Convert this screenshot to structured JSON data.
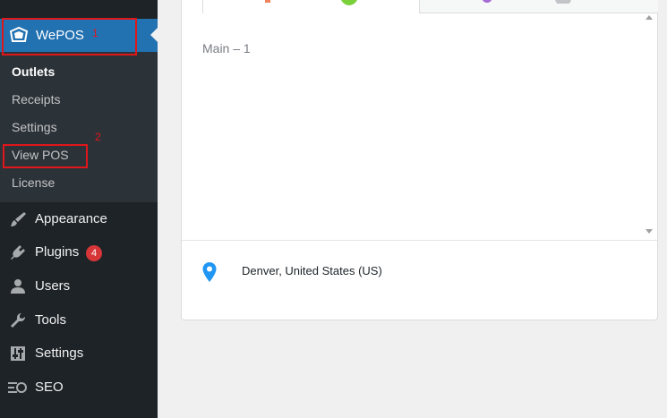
{
  "sidebar": {
    "plugin_name": "WePOS",
    "submenu": [
      "Outlets",
      "Receipts",
      "Settings",
      "View POS",
      "License"
    ],
    "items": [
      {
        "label": "Appearance",
        "icon": "paintbrush-icon"
      },
      {
        "label": "Plugins",
        "icon": "plugin-icon",
        "badge": "4"
      },
      {
        "label": "Users",
        "icon": "users-icon"
      },
      {
        "label": "Tools",
        "icon": "wrench-icon"
      },
      {
        "label": "Settings",
        "icon": "settings-sliders-icon"
      },
      {
        "label": "SEO",
        "icon": "seo-icon"
      }
    ]
  },
  "annotations": {
    "first": "1",
    "second": "2"
  },
  "main": {
    "outlet_text": "Main  – 1",
    "location": "Denver, United States (US)"
  },
  "colors": {
    "accent": "#2271b1",
    "sidebar": "#1d2327",
    "submenu": "#2c3338",
    "badge": "#d63638",
    "annotation": "#e0161b",
    "pin": "#2196f3"
  }
}
